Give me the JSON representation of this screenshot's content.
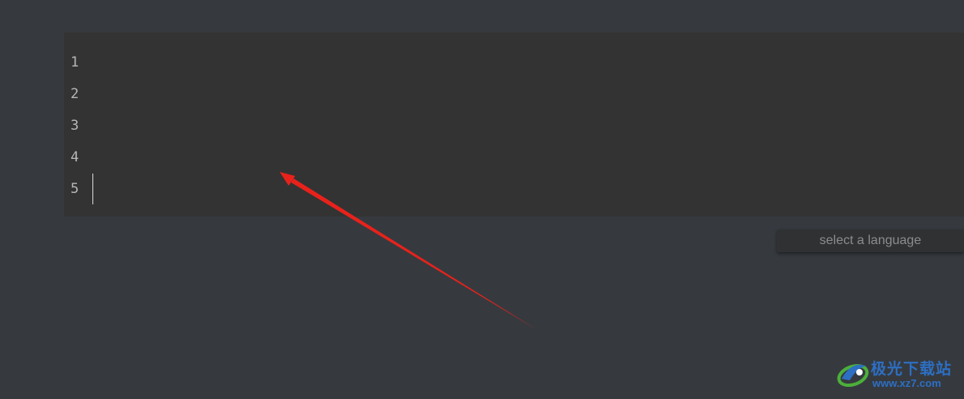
{
  "editor": {
    "line_numbers": [
      "1",
      "2",
      "3",
      "4",
      "5"
    ]
  },
  "language_select": {
    "placeholder": "select a language"
  },
  "watermark": {
    "site_name": "极光下载站",
    "url": "www.xz7.com"
  },
  "colors": {
    "page_bg": "#363a3f",
    "editor_bg": "#333333",
    "annotation_arrow": "#e8221b",
    "watermark_blue": "#2d6fc3",
    "watermark_green": "#4caf3a"
  }
}
